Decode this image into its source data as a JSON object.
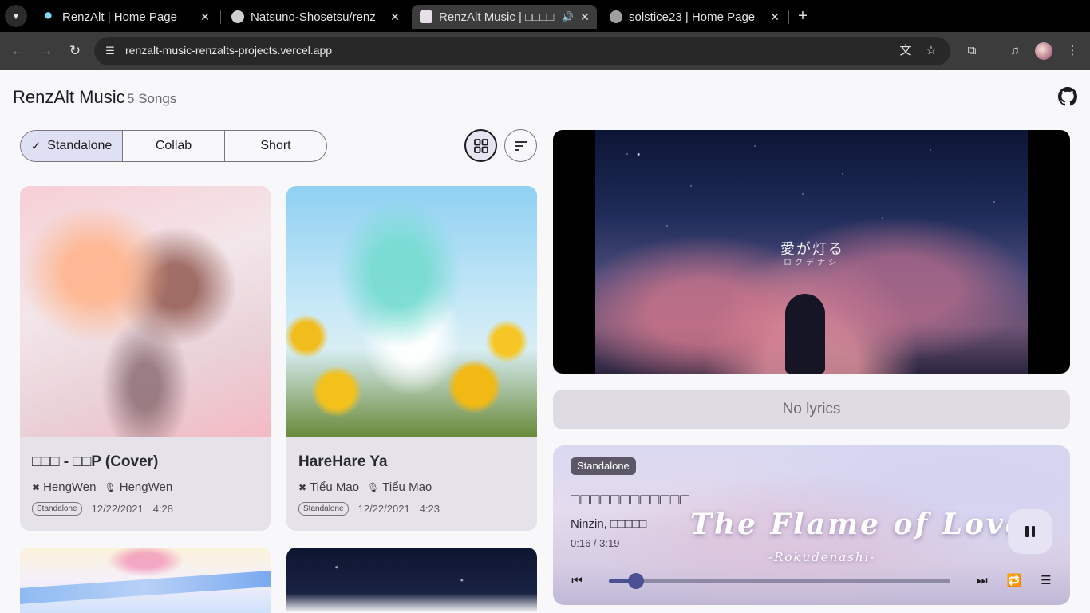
{
  "browser": {
    "tabs": [
      {
        "title": "RenzAlt | Home Page",
        "close": "✕"
      },
      {
        "title": "Natsuno-Shosetsu/renz",
        "close": "✕"
      },
      {
        "title": "RenzAlt Music | □□□□",
        "close": "✕",
        "audio_icon": "speaker-icon"
      },
      {
        "title": "solstice23 | Home Page",
        "close": "✕"
      }
    ],
    "new_tab": "+",
    "url": "renzalt-music-renzalts-projects.vercel.app"
  },
  "app": {
    "title": "RenzAlt Music",
    "song_count": "5 Songs"
  },
  "filters": {
    "segments": [
      "Standalone",
      "Collab",
      "Short"
    ],
    "selected": "Standalone",
    "check_glyph": "✓"
  },
  "songs": [
    {
      "title": "□□□ - □□P (Cover)",
      "composer": "HengWen",
      "vocalist": "HengWen",
      "type": "Standalone",
      "date": "12/22/2021",
      "duration": "4:28"
    },
    {
      "title": "HareHare Ya",
      "composer": "Tiểu Mao",
      "vocalist": "Tiểu Mao",
      "type": "Standalone",
      "date": "12/22/2021",
      "duration": "4:23"
    }
  ],
  "video": {
    "overlay_title": "愛が灯る",
    "overlay_subtitle": "ロクデナシ"
  },
  "lyrics": {
    "empty_text": "No lyrics"
  },
  "player": {
    "type_chip": "Standalone",
    "title": "□□□□□□□□□□□□",
    "artists": "Ninzin, □□□□□",
    "time": "0:16 / 3:19",
    "progress": 0.08,
    "art_title": "The Flame of Love",
    "art_subtitle": "-Rokudenashi-"
  },
  "colors": {
    "accent": "#4b4f93",
    "selected_segment": "#e0e0f4",
    "card_bg": "#e5e3e9"
  }
}
